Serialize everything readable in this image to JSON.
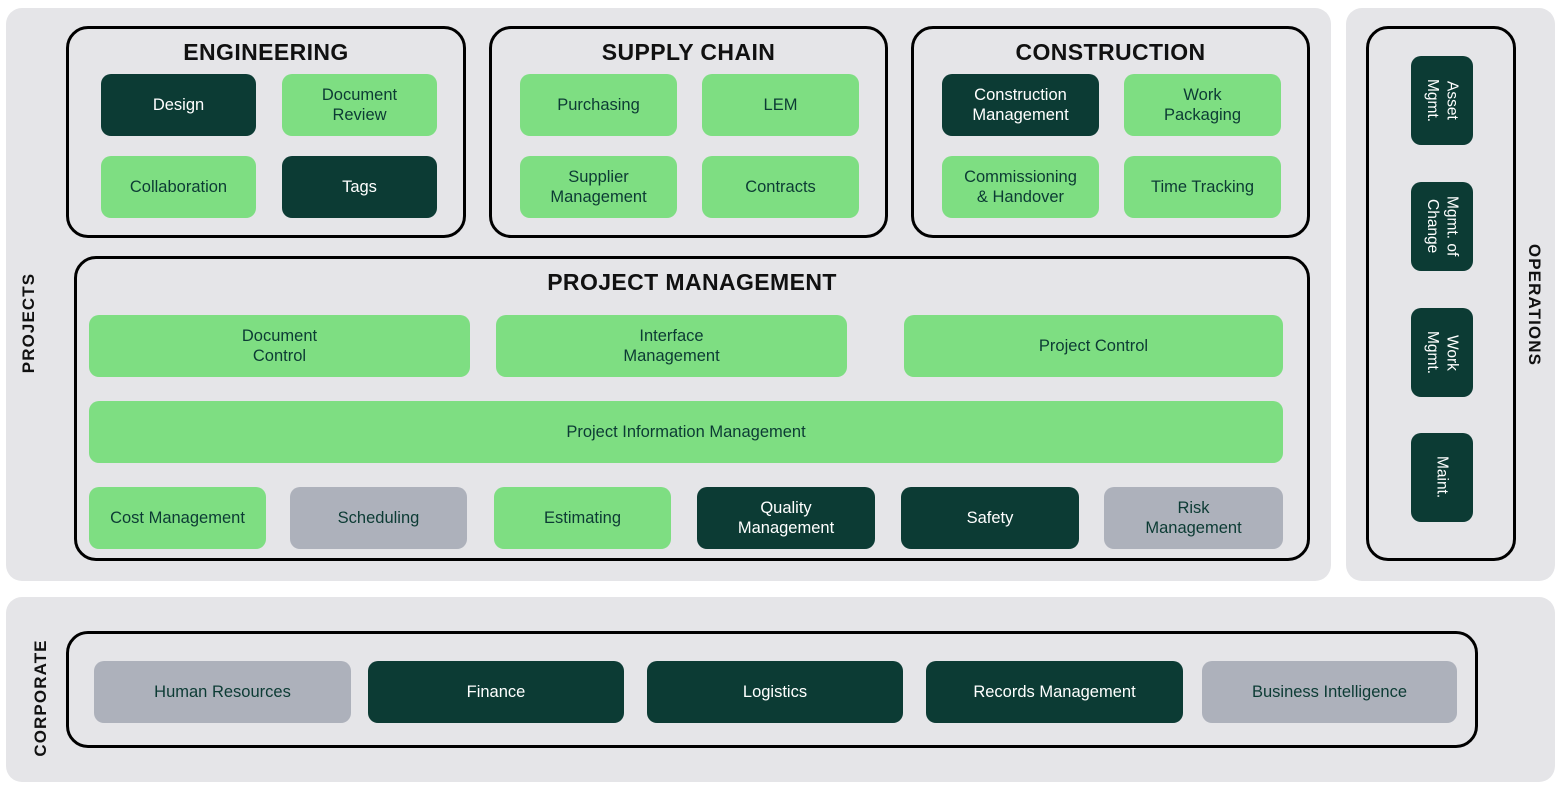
{
  "colors": {
    "dark": "#0c3b34",
    "green": "#7ede82",
    "gray": "#adb1bb",
    "panel": "#e5e5e8",
    "outline": "#000000",
    "text_on_dark": "#ffffff",
    "text_on_light": "#0c3b34"
  },
  "groups": {
    "projects_label": "PROJECTS",
    "operations_label": "OPERATIONS",
    "corporate_label": "CORPORATE"
  },
  "engineering": {
    "title": "ENGINEERING",
    "tiles": [
      {
        "label": "Design",
        "style": "dark"
      },
      {
        "label": "Document\nReview",
        "style": "green"
      },
      {
        "label": "Collaboration",
        "style": "green"
      },
      {
        "label": "Tags",
        "style": "dark"
      }
    ]
  },
  "supply_chain": {
    "title": "SUPPLY CHAIN",
    "tiles": [
      {
        "label": "Purchasing",
        "style": "green"
      },
      {
        "label": "LEM",
        "style": "green"
      },
      {
        "label": "Supplier\nManagement",
        "style": "green"
      },
      {
        "label": "Contracts",
        "style": "green"
      }
    ]
  },
  "construction": {
    "title": "CONSTRUCTION",
    "tiles": [
      {
        "label": "Construction\nManagement",
        "style": "dark"
      },
      {
        "label": "Work\nPackaging",
        "style": "green"
      },
      {
        "label": "Commissioning\n& Handover",
        "style": "green"
      },
      {
        "label": "Time Tracking",
        "style": "green"
      }
    ]
  },
  "project_management": {
    "title": "PROJECT MANAGEMENT",
    "row1": [
      {
        "label": "Document\nControl",
        "style": "green"
      },
      {
        "label": "Interface\nManagement",
        "style": "green"
      },
      {
        "label": "Project Control",
        "style": "green"
      }
    ],
    "row2": [
      {
        "label": "Project Information Management",
        "style": "green"
      }
    ],
    "row3": [
      {
        "label": "Cost Management",
        "style": "green"
      },
      {
        "label": "Scheduling",
        "style": "gray"
      },
      {
        "label": "Estimating",
        "style": "green"
      },
      {
        "label": "Quality\nManagement",
        "style": "dark"
      },
      {
        "label": "Safety",
        "style": "dark"
      },
      {
        "label": "Risk\nManagement",
        "style": "gray"
      }
    ]
  },
  "operations": {
    "tiles": [
      {
        "label": "Asset\nMgmt.",
        "style": "dark"
      },
      {
        "label": "Mgmt. of\nChange",
        "style": "dark"
      },
      {
        "label": "Work\nMgmt.",
        "style": "dark"
      },
      {
        "label": "Maint.",
        "style": "dark"
      }
    ]
  },
  "corporate": {
    "tiles": [
      {
        "label": "Human Resources",
        "style": "gray"
      },
      {
        "label": "Finance",
        "style": "dark"
      },
      {
        "label": "Logistics",
        "style": "dark"
      },
      {
        "label": "Records Management",
        "style": "dark"
      },
      {
        "label": "Business Intelligence",
        "style": "gray"
      }
    ]
  }
}
